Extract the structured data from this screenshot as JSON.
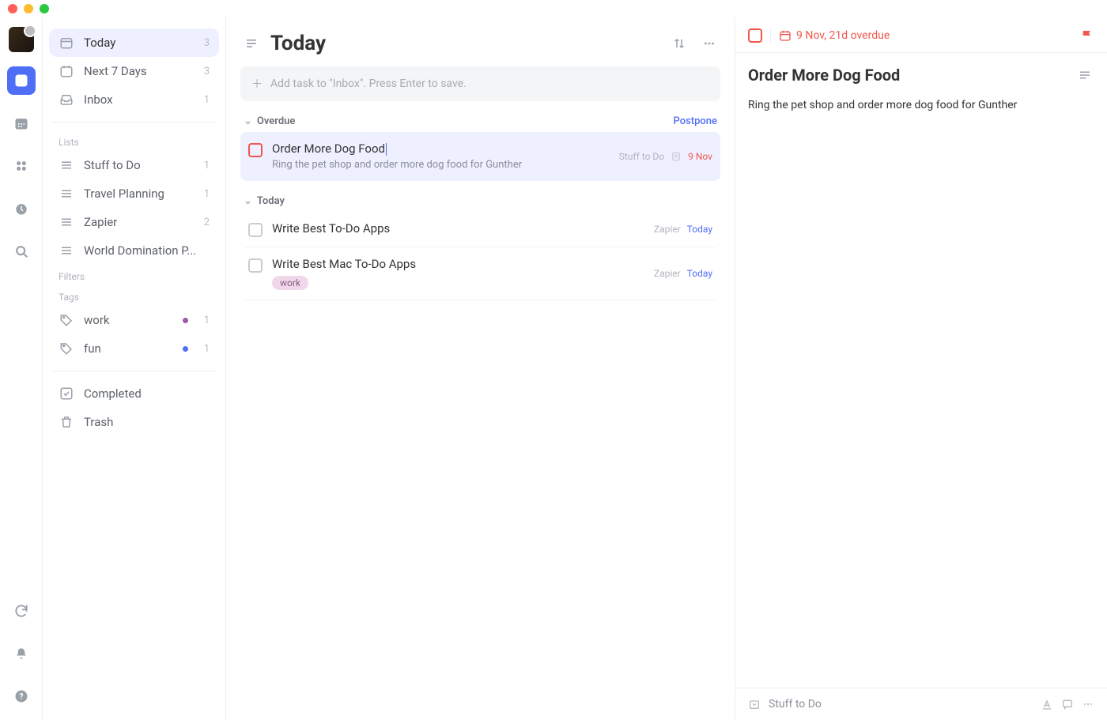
{
  "sidebar": {
    "today": {
      "label": "Today",
      "count": "3"
    },
    "next7": {
      "label": "Next 7 Days",
      "count": "3"
    },
    "inbox": {
      "label": "Inbox",
      "count": "1"
    },
    "lists_heading": "Lists",
    "lists": [
      {
        "label": "Stuff to Do",
        "count": "1"
      },
      {
        "label": "Travel Planning",
        "count": "1"
      },
      {
        "label": "Zapier",
        "count": "2"
      },
      {
        "label": "World Domination P...",
        "count": ""
      }
    ],
    "filters_heading": "Filters",
    "tags_heading": "Tags",
    "tags": [
      {
        "label": "work",
        "count": "1",
        "color": "#9c5aa6"
      },
      {
        "label": "fun",
        "count": "1",
        "color": "#4f6ef7"
      }
    ],
    "completed": "Completed",
    "trash": "Trash"
  },
  "main": {
    "title": "Today",
    "add_placeholder": "Add task to \"Inbox\". Press Enter to save.",
    "sections": {
      "overdue": "Overdue",
      "postpone": "Postpone",
      "today": "Today"
    },
    "tasks": [
      {
        "title": "Order More Dog Food",
        "desc": "Ring the pet shop and order more dog food for Gunther",
        "list": "Stuff to Do",
        "date": "9 Nov",
        "overdue": true
      },
      {
        "title": "Write Best To-Do Apps",
        "list": "Zapier",
        "date": "Today",
        "overdue": false
      },
      {
        "title": "Write Best Mac To-Do Apps",
        "list": "Zapier",
        "date": "Today",
        "overdue": false,
        "tag": "work"
      }
    ]
  },
  "detail": {
    "date_text": "9 Nov, 21d overdue",
    "title": "Order More Dog Food",
    "desc": "Ring the pet shop and order more dog food for Gunther",
    "footer_list": "Stuff to Do"
  }
}
